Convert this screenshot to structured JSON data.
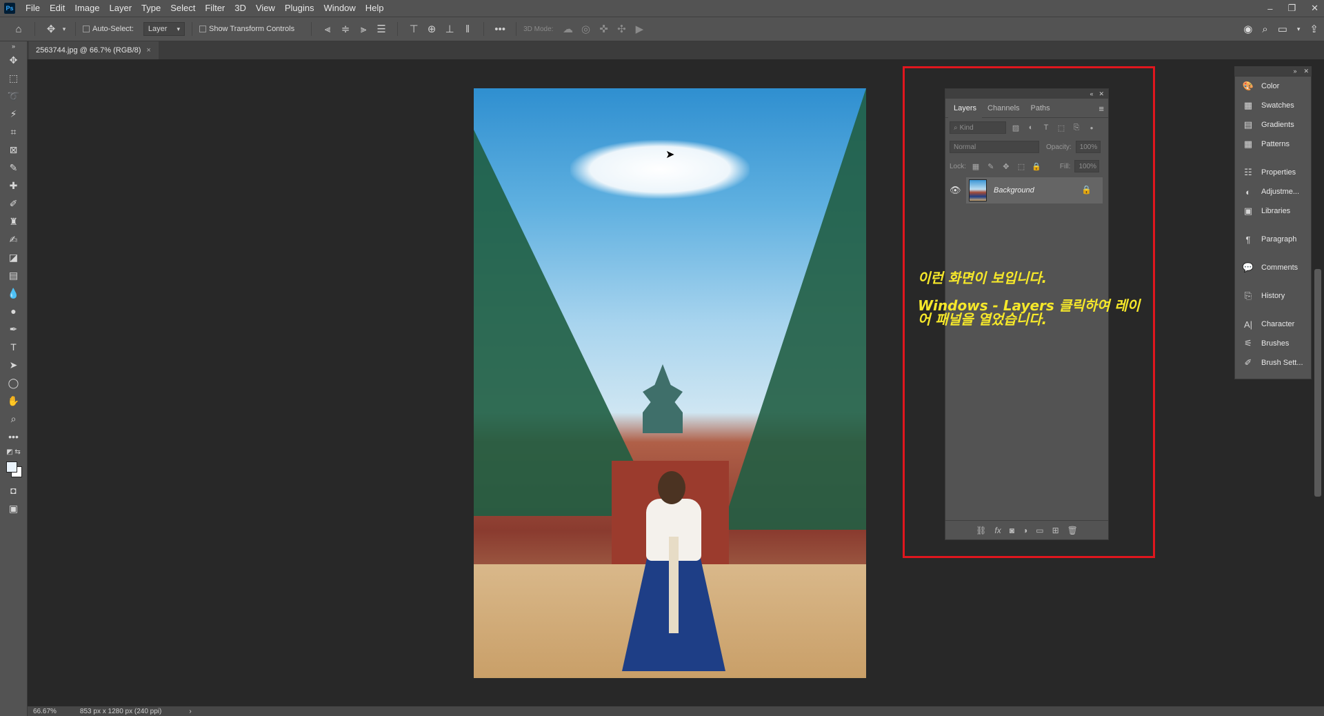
{
  "app": {
    "logo": "Ps"
  },
  "menu": [
    "File",
    "Edit",
    "Image",
    "Layer",
    "Type",
    "Select",
    "Filter",
    "3D",
    "View",
    "Plugins",
    "Window",
    "Help"
  ],
  "window_controls": [
    "–",
    "❐",
    "✕"
  ],
  "options_bar": {
    "auto_select_label": "Auto-Select:",
    "auto_select_value": "Layer",
    "transform_label": "Show Transform Controls",
    "mode_3d_label": "3D Mode:"
  },
  "document": {
    "tab_title": "2563744.jpg @ 66.7% (RGB/8)",
    "close_glyph": "×"
  },
  "status": {
    "zoom": "66.67%",
    "info": "853 px x 1280 px (240 ppi)",
    "arrow": "›"
  },
  "layers_panel": {
    "tabs": [
      "Layers",
      "Channels",
      "Paths"
    ],
    "kind_placeholder": "Kind",
    "blend_mode": "Normal",
    "opacity_label": "Opacity:",
    "opacity_value": "100%",
    "lock_label": "Lock:",
    "fill_label": "Fill:",
    "fill_value": "100%",
    "layers": [
      {
        "name": "Background",
        "visible": true,
        "locked": true
      }
    ]
  },
  "annotation": {
    "line1": "이런 화면이 보입니다.",
    "line2": "Windows - Layers 클릭하여 레이어 패널을 열었습니다."
  },
  "right_panels": {
    "group1": [
      "Color",
      "Swatches",
      "Gradients",
      "Patterns"
    ],
    "group2": [
      "Properties",
      "Adjustme...",
      "Libraries"
    ],
    "group3": [
      "Paragraph"
    ],
    "group4": [
      "Comments"
    ],
    "group5": [
      "History"
    ],
    "group6": [
      "Character",
      "Brushes",
      "Brush Sett..."
    ]
  }
}
